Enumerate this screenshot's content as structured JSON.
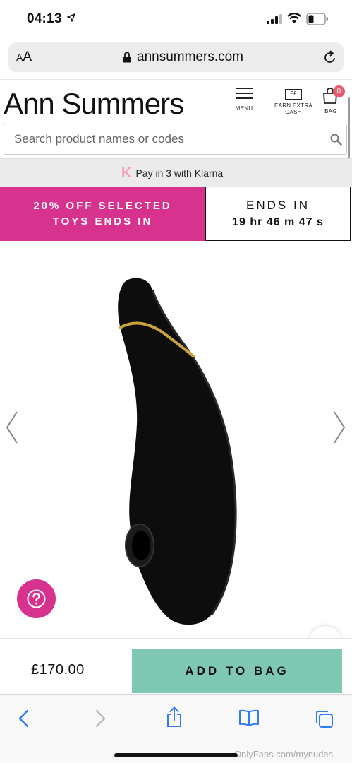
{
  "status_bar": {
    "time": "04:13"
  },
  "browser": {
    "aa_small": "A",
    "aa_large": "A",
    "url": "annsummers.com"
  },
  "header": {
    "logo": "Ann Summers",
    "menu_label": "MENU",
    "cash_icon_text": "££",
    "cash_label_1": "EARN EXTRA",
    "cash_label_2": "CASH",
    "bag_label": "BAG",
    "bag_count": "0"
  },
  "search": {
    "placeholder": "Search product names or codes"
  },
  "klarna": {
    "logo": "K",
    "text": "Pay in 3 with Klarna"
  },
  "promo": {
    "line1": "20% OFF SELECTED",
    "line2": "TOYS ENDS IN",
    "ends_label": "ENDS IN",
    "countdown": "19 hr 46 m 47 s"
  },
  "purchase": {
    "price": "£170.00",
    "add_label": "ADD TO BAG"
  },
  "watermark": "OnlyFans.com/mynudes",
  "colors": {
    "promo_pink": "#d8328f",
    "add_button_green": "#7fc8b3",
    "safari_blue": "#2f7cf6",
    "bag_badge": "#e35e6f"
  },
  "icons": [
    "location-arrow-icon",
    "signal-icon",
    "wifi-icon",
    "battery-icon",
    "lock-icon",
    "reload-icon",
    "menu-icon",
    "cash-icon",
    "bag-icon",
    "search-icon",
    "klarna-logo",
    "chevron-left-icon",
    "chevron-right-icon",
    "help-icon",
    "back-icon",
    "forward-icon",
    "share-icon",
    "bookmarks-icon",
    "tabs-icon"
  ]
}
